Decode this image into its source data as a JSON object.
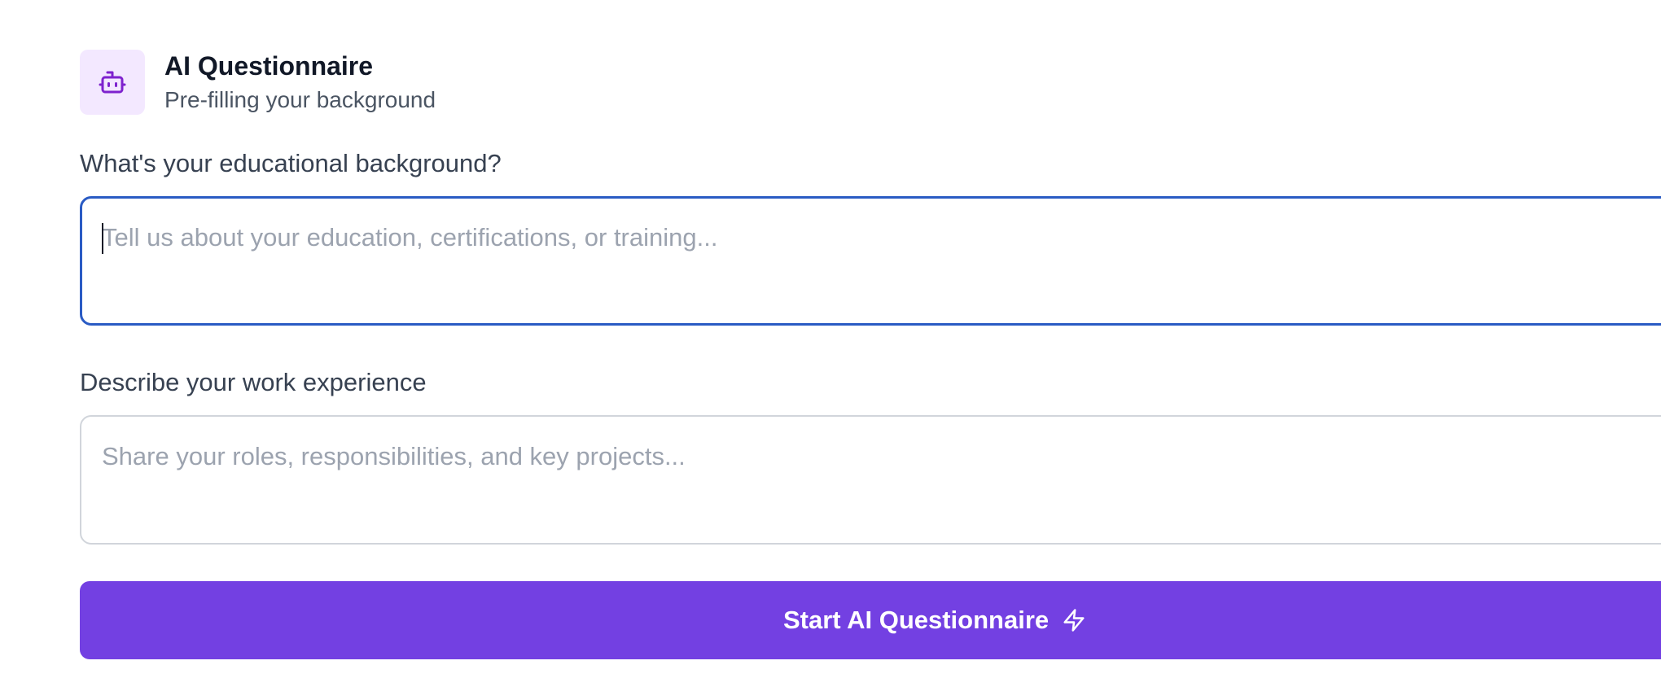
{
  "header": {
    "icon": "bot-icon",
    "icon_color": "#7e22ce",
    "icon_background": "#f3e8ff",
    "title": "AI Questionnaire",
    "subtitle": "Pre-filling your background"
  },
  "form": {
    "education": {
      "label": "What's your educational background?",
      "placeholder": "Tell us about your education, certifications, or training...",
      "value": "",
      "focused": true,
      "focus_border_color": "#2a5bc4"
    },
    "experience": {
      "label": "Describe your work experience",
      "placeholder": "Share your roles, responsibilities, and key projects...",
      "value": "",
      "focused": false
    }
  },
  "start_button": {
    "label": "Start AI Questionnaire",
    "icon": "lightning-icon",
    "background_color": "#7340e2"
  }
}
